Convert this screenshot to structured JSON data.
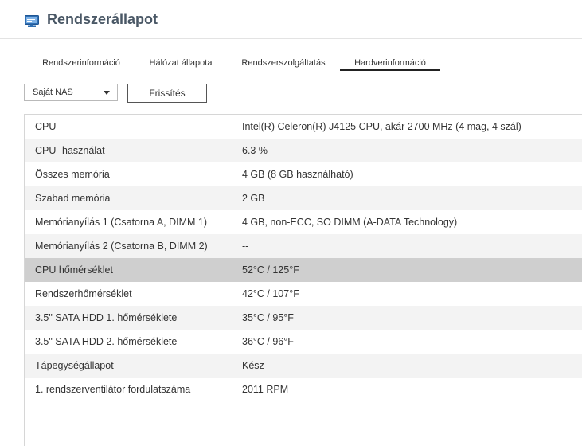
{
  "app": {
    "title": "Rendszerállapot",
    "icon": "monitor-icon",
    "accent": "#2f6fb3"
  },
  "tabs": [
    {
      "label": "Rendszerinformáció",
      "active": false
    },
    {
      "label": "Hálózat állapota",
      "active": false
    },
    {
      "label": "Rendszerszolgáltatás",
      "active": false
    },
    {
      "label": "Hardverinformáció",
      "active": true
    }
  ],
  "toolbar": {
    "device_select": "Saját NAS",
    "refresh_label": "Frissítés"
  },
  "hardware_table": {
    "rows": [
      {
        "label": "CPU",
        "value": "Intel(R) Celeron(R) J4125 CPU, akár 2700 MHz (4 mag, 4 szál)"
      },
      {
        "label": "CPU -használat",
        "value": "6.3 %"
      },
      {
        "label": "Összes memória",
        "value": "4 GB (8 GB használható)"
      },
      {
        "label": "Szabad memória",
        "value": "2 GB"
      },
      {
        "label": "Memórianyílás 1 (Csatorna A, DIMM 1)",
        "value": "4 GB, non-ECC, SO DIMM (A-DATA Technology)"
      },
      {
        "label": "Memórianyílás 2 (Csatorna B, DIMM 2)",
        "value": "--"
      },
      {
        "label": "CPU hőmérséklet",
        "value": "52°C / 125°F"
      },
      {
        "label": "Rendszerhőmérséklet",
        "value": "42°C / 107°F"
      },
      {
        "label": "3.5\" SATA HDD 1. hőmérséklete",
        "value": "35°C / 95°F"
      },
      {
        "label": "3.5\" SATA HDD 2. hőmérséklete",
        "value": "36°C / 96°F"
      },
      {
        "label": "Tápegységállapot",
        "value": "Kész"
      },
      {
        "label": "1. rendszerventilátor fordulatszáma",
        "value": "2011 RPM"
      }
    ],
    "selected_row": "CPU hőmérséklet"
  }
}
